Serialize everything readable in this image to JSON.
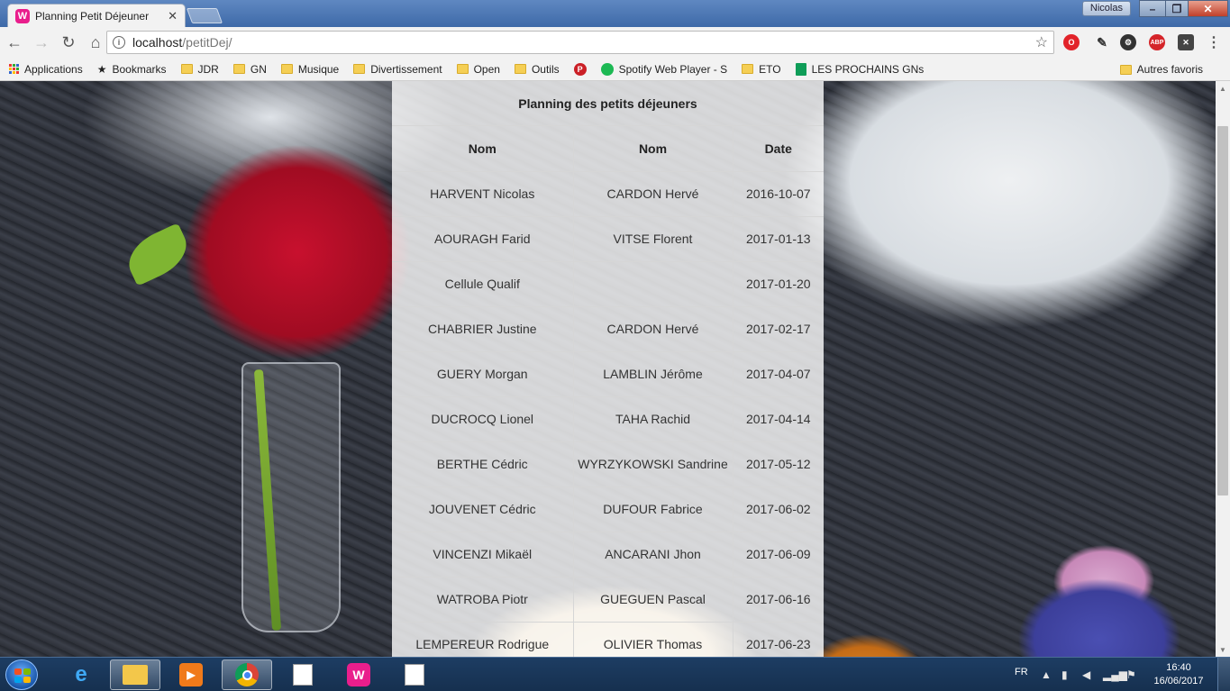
{
  "browser": {
    "tab_title": "Planning Petit Déjeuner",
    "tab_favicon": "W",
    "user_name": "Nicolas",
    "url_host": "localhost",
    "url_path": "/petitDej/",
    "bookmarks": [
      {
        "label": "Applications",
        "icon": "apps-grid-icon"
      },
      {
        "label": "Bookmarks",
        "icon": "star-icon"
      },
      {
        "label": "JDR",
        "icon": "folder-icon"
      },
      {
        "label": "GN",
        "icon": "folder-icon"
      },
      {
        "label": "Musique",
        "icon": "folder-icon"
      },
      {
        "label": "Divertissement",
        "icon": "folder-icon"
      },
      {
        "label": "Open",
        "icon": "folder-icon"
      },
      {
        "label": "Outils",
        "icon": "folder-icon"
      },
      {
        "label": "",
        "icon": "pinterest-icon"
      },
      {
        "label": "Spotify Web Player - S",
        "icon": "spotify-icon"
      },
      {
        "label": "ETO",
        "icon": "folder-icon"
      },
      {
        "label": "LES PROCHAINS GNs",
        "icon": "sheets-icon"
      }
    ],
    "other_bookmarks": "Autres favoris",
    "extensions": {
      "adblock": "ABP"
    }
  },
  "planning": {
    "caption": "Planning des petits déjeuners",
    "headers": [
      "Nom",
      "Nom",
      "Date"
    ],
    "rows": [
      [
        "HARVENT Nicolas",
        "CARDON Hervé",
        "2016-10-07"
      ],
      [
        "AOURAGH Farid",
        "VITSE Florent",
        "2017-01-13"
      ],
      [
        "Cellule Qualif",
        "",
        "2017-01-20"
      ],
      [
        "CHABRIER Justine",
        "CARDON Hervé",
        "2017-02-17"
      ],
      [
        "GUERY Morgan",
        "LAMBLIN Jérôme",
        "2017-04-07"
      ],
      [
        "DUCROCQ Lionel",
        "TAHA Rachid",
        "2017-04-14"
      ],
      [
        "BERTHE Cédric",
        "WYRZYKOWSKI Sandrine",
        "2017-05-12"
      ],
      [
        "JOUVENET Cédric",
        "DUFOUR Fabrice",
        "2017-06-02"
      ],
      [
        "VINCENZI Mikaël",
        "ANCARANI Jhon",
        "2017-06-09"
      ],
      [
        "WATROBA Piotr",
        "GUEGUEN Pascal",
        "2017-06-16"
      ],
      [
        "LEMPEREUR Rodrigue",
        "OLIVIER Thomas",
        "2017-06-23"
      ]
    ]
  },
  "taskbar": {
    "language": "FR",
    "time": "16:40",
    "date": "16/06/2017",
    "apps": [
      "internet-explorer-icon",
      "file-explorer-icon",
      "media-player-icon",
      "chrome-icon",
      "app-window-icon",
      "wamp-icon",
      "app-window-icon"
    ]
  }
}
